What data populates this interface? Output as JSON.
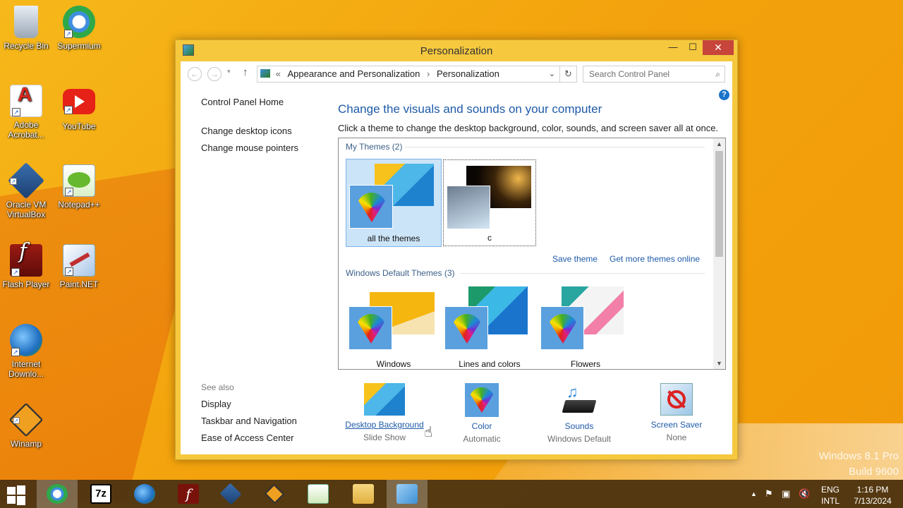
{
  "desktop": {
    "icons": [
      {
        "label": "Recycle Bin"
      },
      {
        "label": "Supermium"
      },
      {
        "label": "Adobe Acrobat..."
      },
      {
        "label": "YouTube"
      },
      {
        "label": "Oracle VM VirtualBox"
      },
      {
        "label": "Notepad++"
      },
      {
        "label": "Flash Player"
      },
      {
        "label": "Paint.NET"
      },
      {
        "label": "Internet Downlo..."
      },
      {
        "label": "Winamp"
      }
    ],
    "watermark": {
      "line1": "Windows 8.1 Pro",
      "line2": "Build 9600"
    }
  },
  "window": {
    "title": "Personalization",
    "buttons": {
      "minimize": "—",
      "maximize": "☐",
      "close": "✕"
    },
    "address": {
      "prefix": "«",
      "crumbs": [
        "Appearance and Personalization",
        "Personalization"
      ]
    },
    "search": {
      "placeholder": "Search Control Panel"
    },
    "help": "?",
    "left_nav": {
      "home": "Control Panel Home",
      "links": [
        "Change desktop icons",
        "Change mouse pointers"
      ]
    },
    "see_also": {
      "header": "See also",
      "links": [
        "Display",
        "Taskbar and Navigation",
        "Ease of Access Center"
      ]
    },
    "heading": "Change the visuals and sounds on your computer",
    "description": "Click a theme to change the desktop background, color, sounds, and screen saver all at once.",
    "my_themes": {
      "title": "My Themes (2)",
      "items": [
        {
          "label": "all the themes",
          "selected": true
        },
        {
          "label": "c",
          "selected": false
        }
      ],
      "save_theme": "Save theme",
      "get_more": "Get more themes online"
    },
    "default_themes": {
      "title": "Windows Default Themes (3)",
      "items": [
        {
          "label": "Windows"
        },
        {
          "label": "Lines and colors"
        },
        {
          "label": "Flowers"
        }
      ]
    },
    "bottom": [
      {
        "title": "Desktop Background",
        "sub": "Slide Show",
        "icon": "desktop-background-icon"
      },
      {
        "title": "Color",
        "sub": "Automatic",
        "icon": "color-palette-icon"
      },
      {
        "title": "Sounds",
        "sub": "Windows Default",
        "icon": "sounds-icon"
      },
      {
        "title": "Screen Saver",
        "sub": "None",
        "icon": "screen-saver-icon"
      }
    ]
  },
  "taskbar": {
    "tray": {
      "lang1": "ENG",
      "lang2": "INTL",
      "time": "1:16 PM",
      "date": "7/13/2024"
    }
  },
  "colors": {
    "accent": "#1e5aa8",
    "window_frame": "#f5c83e",
    "close": "#c7453a"
  }
}
